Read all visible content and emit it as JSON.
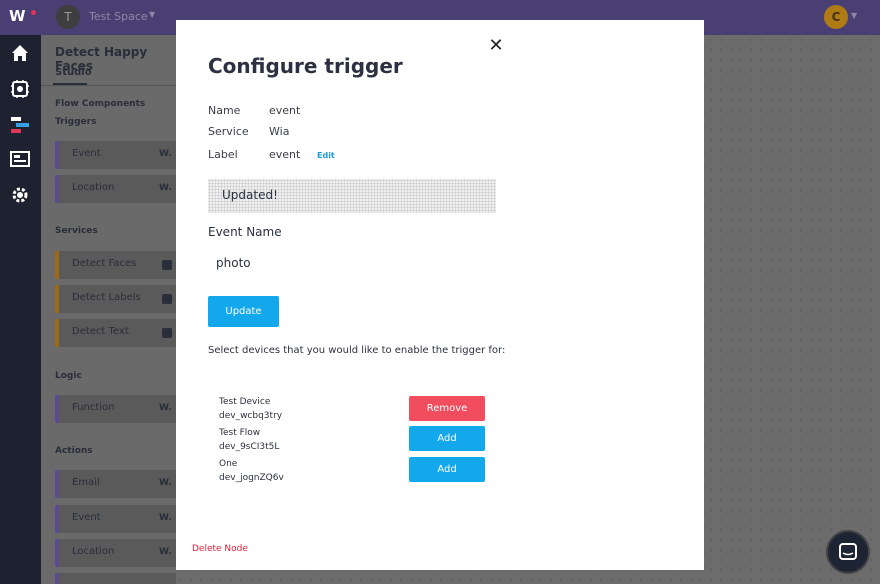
{
  "topbar": {
    "space_avatar_letter": "T",
    "space_name": "Test Space",
    "user_avatar_letter": "C"
  },
  "rail": {
    "icons": [
      "home-icon",
      "device-icon",
      "flows-icon",
      "dashboard-icon",
      "settings-icon"
    ]
  },
  "sidebar": {
    "flow_title": "Detect Happy Faces",
    "tab": "Studio",
    "flow_components_label": "Flow Components",
    "sections": {
      "triggers": {
        "label": "Triggers",
        "items": [
          "Event",
          "Location"
        ]
      },
      "services": {
        "label": "Services",
        "items": [
          "Detect Faces",
          "Detect Labels",
          "Detect Text"
        ]
      },
      "logic": {
        "label": "Logic",
        "items": [
          "Function"
        ]
      },
      "actions": {
        "label": "Actions",
        "items": [
          "Email",
          "Event",
          "Location"
        ]
      }
    }
  },
  "modal": {
    "title": "Configure trigger",
    "name_key": "Name",
    "name_value": "event",
    "service_key": "Service",
    "service_value": "Wia",
    "label_key": "Label",
    "label_value": "event",
    "edit_label": "Edit",
    "status_message": "Updated!",
    "event_name_label": "Event Name",
    "event_name_value": "photo",
    "update_label": "Update",
    "select_devices_text": "Select devices that you would like to enable the trigger for:",
    "devices": [
      {
        "name": "Test Device",
        "id": "dev_wcbq3try",
        "action": "Remove"
      },
      {
        "name": "Test Flow",
        "id": "dev_9sCI3t5L",
        "action": "Add"
      },
      {
        "name": "One",
        "id": "dev_jognZQ6v",
        "action": "Add"
      }
    ],
    "delete_label": "Delete Node"
  },
  "colors": {
    "topbar": "#4a3f72",
    "rail": "#1e2230",
    "accent_blue": "#13a8ec",
    "remove_red": "#f24d5f",
    "delete_red": "#e0213c"
  }
}
